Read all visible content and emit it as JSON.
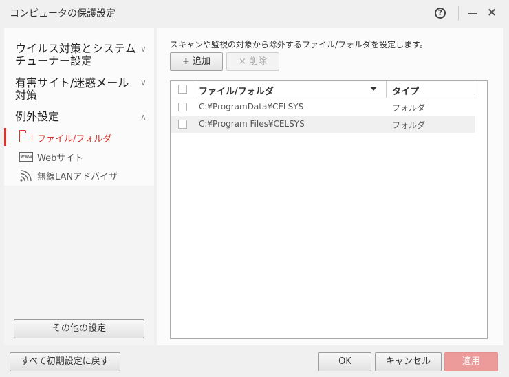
{
  "window": {
    "title": "コンピュータの保護設定",
    "help_glyph": "?",
    "close_glyph": "×"
  },
  "sidebar": {
    "categories": [
      {
        "label": "ウイルス対策とシステムチューナー設定",
        "expanded": false
      },
      {
        "label": "有害サイト/迷惑メール対策",
        "expanded": false
      },
      {
        "label": "例外設定",
        "expanded": true
      }
    ],
    "subitems": [
      {
        "label": "ファイル/フォルダ",
        "icon": "folder-icon",
        "active": true
      },
      {
        "label": "Webサイト",
        "icon": "www-icon",
        "icon_text": "www",
        "active": false
      },
      {
        "label": "無線LANアドバイザ",
        "icon": "wifi-icon",
        "active": false
      }
    ],
    "other_settings_label": "その他の設定"
  },
  "main": {
    "description": "スキャンや監視の対象から除外するファイル/フォルダを設定します。",
    "add_label": "追加",
    "add_glyph": "+",
    "delete_label": "削除",
    "delete_glyph": "×",
    "table": {
      "columns": [
        "ファイル/フォルダ",
        "タイプ"
      ],
      "rows": [
        {
          "path": "C:¥ProgramData¥CELSYS",
          "type": "フォルダ"
        },
        {
          "path": "C:¥Program Files¥CELSYS",
          "type": "フォルダ"
        }
      ]
    }
  },
  "footer": {
    "reset_label": "すべて初期設定に戻す",
    "ok_label": "OK",
    "cancel_label": "キャンセル",
    "apply_label": "適用"
  },
  "colors": {
    "accent": "#d9342b",
    "apply_disabled": "#ec9a9a"
  }
}
